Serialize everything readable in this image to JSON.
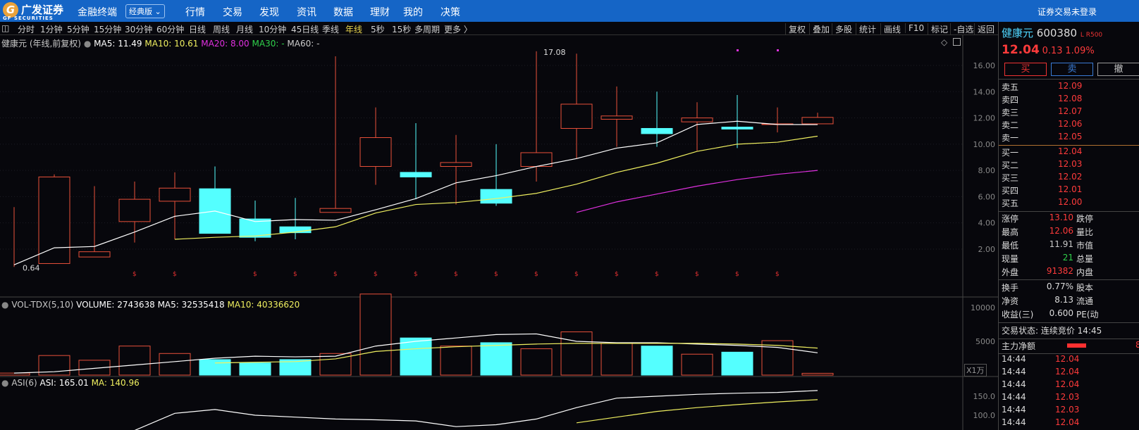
{
  "header": {
    "logo": "广发证券",
    "logo_sub": "GF SECURITIES",
    "brand": "金融终端",
    "version": "经典版",
    "nav": [
      "行情",
      "交易",
      "发现",
      "资讯",
      "数据",
      "理财",
      "我的",
      "决策"
    ],
    "login": "证券交易未登录"
  },
  "toolbar": {
    "periods": [
      "分时",
      "1分钟",
      "5分钟",
      "15分钟",
      "30分钟",
      "60分钟",
      "日线",
      "周线",
      "月线",
      "10分钟",
      "45日线",
      "季线",
      "年线",
      "5秒",
      "15秒",
      "多周期",
      "更多 〉"
    ],
    "active": "年线",
    "tools": [
      "复权",
      "叠加",
      "多股",
      "统计",
      "画线",
      "F10",
      "标记",
      "-自选",
      "返回"
    ]
  },
  "main_legend": {
    "name": "健康元 (年线,前复权)",
    "ma5": "MA5: 11.49",
    "ma10": "MA10: 10.61",
    "ma20": "MA20: 8.00",
    "ma30": "MA30: -",
    "ma60": "MA60: -"
  },
  "vol_legend": {
    "name": "VOL-TDX(5,10)",
    "volume": "VOLUME: 2743638",
    "ma5": "MA5: 32535418",
    "ma10": "MA10: 40336620",
    "unit": "X1万"
  },
  "asi_legend": {
    "name": "ASI(6)",
    "asi": "ASI: 165.01",
    "ma": "MA: 140.96"
  },
  "colors": {
    "up": "#e8503a",
    "down": "#54ffff",
    "ma5": "#ffffff",
    "ma10": "#f0f060",
    "ma20": "#e030e0"
  },
  "chart_data": {
    "type": "candlestick",
    "price_axis": {
      "ticks": [
        "16.00",
        "14.00",
        "12.00",
        "10.00",
        "8.00",
        "6.00",
        "4.00",
        "2.00"
      ],
      "range": [
        0,
        17.5
      ]
    },
    "annotations": {
      "high": "17.08",
      "low": "0.64"
    },
    "ohlc": [
      [
        0.64,
        5.2,
        0.64,
        0.8
      ],
      [
        0.9,
        7.7,
        0.9,
        7.5
      ],
      [
        1.4,
        6.8,
        1.4,
        1.8
      ],
      [
        4.1,
        7.15,
        2.5,
        5.8
      ],
      [
        5.65,
        7.85,
        2.75,
        6.65
      ],
      [
        6.6,
        8.3,
        3.2,
        3.2
      ],
      [
        4.3,
        5.7,
        2.6,
        2.9
      ],
      [
        3.7,
        5.9,
        2.75,
        3.25
      ],
      [
        4.8,
        16.7,
        4.8,
        5.1
      ],
      [
        8.3,
        12.8,
        6.9,
        10.5
      ],
      [
        7.85,
        11.6,
        5.8,
        7.5
      ],
      [
        8.3,
        10.7,
        5.4,
        8.6
      ],
      [
        6.55,
        10.0,
        5.3,
        5.5
      ],
      [
        8.3,
        17.08,
        7.15,
        9.35
      ],
      [
        11.2,
        16.9,
        8.9,
        13.05
      ],
      [
        11.9,
        14.4,
        9.8,
        12.15
      ],
      [
        11.2,
        14.0,
        9.8,
        10.8
      ],
      [
        11.7,
        13.2,
        9.5,
        12.0
      ],
      [
        11.3,
        13.75,
        9.7,
        11.15
      ],
      [
        11.5,
        12.8,
        10.9,
        11.55
      ],
      [
        11.55,
        12.4,
        11.5,
        12.04
      ]
    ],
    "ma5": [
      0.8,
      2.1,
      2.2,
      3.3,
      4.5,
      4.9,
      4.1,
      4.25,
      4.2,
      5.0,
      5.85,
      7.05,
      7.6,
      8.3,
      8.9,
      9.7,
      10.1,
      11.5,
      11.75,
      11.5,
      11.49
    ],
    "ma10": [
      null,
      null,
      null,
      null,
      2.75,
      2.9,
      3.0,
      3.3,
      3.7,
      4.75,
      5.4,
      5.55,
      5.85,
      6.25,
      6.95,
      7.85,
      8.55,
      9.45,
      10.0,
      10.15,
      10.61
    ],
    "ma20": [
      null,
      null,
      null,
      null,
      null,
      null,
      null,
      null,
      null,
      null,
      null,
      null,
      null,
      null,
      4.8,
      5.6,
      6.2,
      6.8,
      7.3,
      7.7,
      8.0
    ],
    "volume_axis": {
      "ticks": [
        "10000",
        "5000"
      ]
    },
    "volume": [
      0.3,
      2.9,
      2.2,
      4.3,
      3.2,
      2.3,
      1.8,
      2.3,
      3.2,
      12.0,
      5.5,
      4.3,
      4.8,
      3.9,
      6.4,
      4.7,
      4.3,
      3.1,
      3.4,
      5.1,
      0.27
    ],
    "vol_ma5": [
      0.3,
      0.5,
      1.0,
      1.5,
      2.0,
      2.5,
      2.8,
      2.7,
      2.8,
      4.3,
      5.0,
      5.5,
      6.0,
      6.1,
      5.0,
      4.8,
      4.8,
      4.6,
      4.4,
      4.1,
      3.3
    ],
    "vol_ma10": [
      null,
      null,
      null,
      null,
      null,
      1.8,
      1.9,
      2.0,
      2.4,
      3.5,
      3.9,
      4.2,
      4.4,
      4.6,
      4.7,
      4.7,
      4.7,
      4.7,
      4.6,
      4.4,
      4.0
    ],
    "asi_axis": {
      "ticks": [
        "150.0",
        "100.0"
      ]
    },
    "asi": [
      null,
      null,
      null,
      60,
      105,
      115,
      100,
      95,
      90,
      88,
      85,
      70,
      75,
      90,
      120,
      145,
      150,
      155,
      158,
      160,
      165
    ],
    "asi_ma": [
      null,
      null,
      null,
      null,
      null,
      null,
      null,
      null,
      null,
      null,
      null,
      null,
      null,
      null,
      80,
      95,
      110,
      120,
      128,
      135,
      141
    ]
  },
  "quote": {
    "name": "健康元",
    "code": "600380",
    "tags": "L R500",
    "price": "12.04",
    "change": "0.13",
    "pct": "1.09%",
    "buy": "买",
    "sell": "卖",
    "cancel": "撤",
    "asks": [
      [
        "卖五",
        "12.09"
      ],
      [
        "卖四",
        "12.08"
      ],
      [
        "卖三",
        "12.07"
      ],
      [
        "卖二",
        "12.06"
      ],
      [
        "卖一",
        "12.05"
      ]
    ],
    "bids": [
      [
        "买一",
        "12.04"
      ],
      [
        "买二",
        "12.03"
      ],
      [
        "买三",
        "12.02"
      ],
      [
        "买四",
        "12.01"
      ],
      [
        "买五",
        "12.00"
      ]
    ],
    "stats": [
      [
        "涨停",
        "13.10",
        "跌停",
        "red"
      ],
      [
        "最高",
        "12.06",
        "量比",
        "red"
      ],
      [
        "最低",
        "11.91",
        "市值",
        ""
      ],
      [
        "现量",
        "21",
        "总量",
        "grn"
      ],
      [
        "外盘",
        "91382",
        "内盘",
        "red"
      ]
    ],
    "stats2": [
      [
        "换手",
        "0.77%",
        "股本"
      ],
      [
        "净资",
        "8.13",
        "流通"
      ],
      [
        "收益(三)",
        "0.600",
        "PE(动"
      ]
    ],
    "status": "交易状态: 连续竞价 14:45",
    "flow_label": "主力净额",
    "flow_val": "8",
    "ticks": [
      [
        "14:44",
        "12.04"
      ],
      [
        "14:44",
        "12.04"
      ],
      [
        "14:44",
        "12.04"
      ],
      [
        "14:44",
        "12.03"
      ],
      [
        "14:44",
        "12.03"
      ],
      [
        "14:44",
        "12.04"
      ]
    ]
  }
}
